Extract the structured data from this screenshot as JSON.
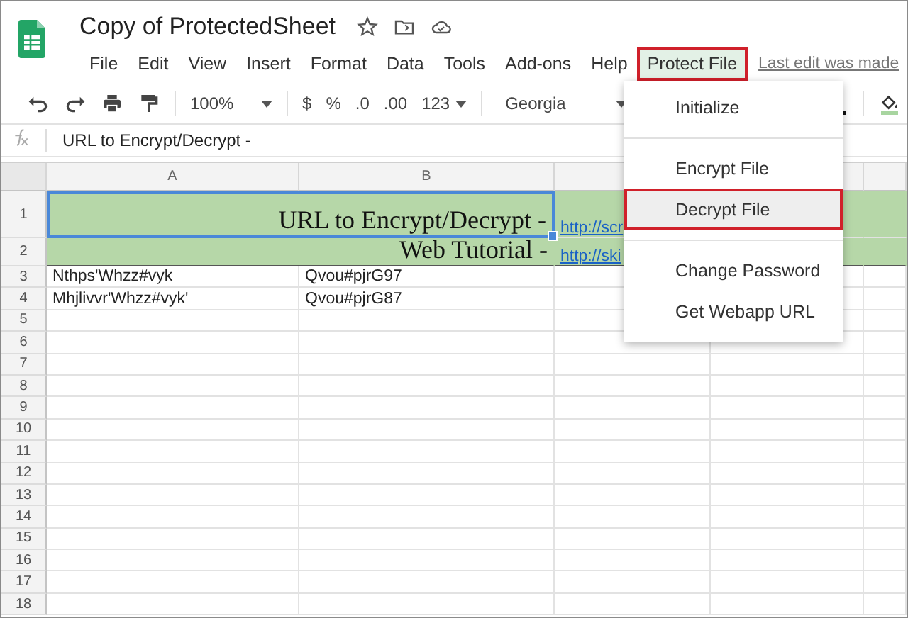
{
  "app": {
    "title": "Copy of ProtectedSheet"
  },
  "menu_bar": [
    {
      "label": "File",
      "selected": false
    },
    {
      "label": "Edit",
      "selected": false
    },
    {
      "label": "View",
      "selected": false
    },
    {
      "label": "Insert",
      "selected": false
    },
    {
      "label": "Format",
      "selected": false
    },
    {
      "label": "Data",
      "selected": false
    },
    {
      "label": "Tools",
      "selected": false
    },
    {
      "label": "Add-ons",
      "selected": false
    },
    {
      "label": "Help",
      "selected": false
    },
    {
      "label": "Protect File",
      "selected": true
    }
  ],
  "last_edit": "Last edit was made",
  "toolbar": {
    "zoom": "100%",
    "currency": "$",
    "percent": "%",
    "decrease_decimal": ".0",
    "increase_decimal": ".00",
    "more_formats": "123",
    "font": "Georgia"
  },
  "formula_bar": {
    "value": "URL to Encrypt/Decrypt -"
  },
  "sheet": {
    "columns": [
      "A",
      "B"
    ],
    "rows": [
      {
        "number": "1",
        "kind": "banner",
        "selected": true,
        "cells": [
          "URL to Encrypt/Decrypt -",
          "http://scr"
        ]
      },
      {
        "number": "2",
        "kind": "banner",
        "selected": false,
        "cells": [
          "Web Tutorial -",
          "http://ski"
        ]
      },
      {
        "number": "3",
        "kind": "data",
        "selected": false,
        "cells": [
          "Nthps'Whzz#vyk",
          "Qvou#pjrG97"
        ]
      },
      {
        "number": "4",
        "kind": "data",
        "selected": false,
        "cells": [
          "Mhjlivvr'Whzz#vyk'",
          "Qvou#pjrG87"
        ]
      },
      {
        "number": "5",
        "kind": "data",
        "selected": false,
        "cells": []
      },
      {
        "number": "6",
        "kind": "data",
        "selected": false,
        "cells": []
      },
      {
        "number": "7",
        "kind": "data",
        "selected": false,
        "cells": []
      },
      {
        "number": "8",
        "kind": "data",
        "selected": false,
        "cells": []
      },
      {
        "number": "9",
        "kind": "data",
        "selected": false,
        "cells": []
      },
      {
        "number": "10",
        "kind": "data",
        "selected": false,
        "cells": []
      },
      {
        "number": "11",
        "kind": "data",
        "selected": false,
        "cells": []
      },
      {
        "number": "12",
        "kind": "data",
        "selected": false,
        "cells": []
      },
      {
        "number": "13",
        "kind": "data",
        "selected": false,
        "cells": []
      },
      {
        "number": "14",
        "kind": "data",
        "selected": false,
        "cells": []
      },
      {
        "number": "15",
        "kind": "data",
        "selected": false,
        "cells": []
      },
      {
        "number": "16",
        "kind": "data",
        "selected": false,
        "cells": []
      },
      {
        "number": "17",
        "kind": "data",
        "selected": false,
        "cells": []
      },
      {
        "number": "18",
        "kind": "data",
        "selected": false,
        "cells": []
      }
    ]
  },
  "dropdown": [
    {
      "kind": "item",
      "label": "Initialize",
      "selected": false
    },
    {
      "kind": "separator"
    },
    {
      "kind": "item",
      "label": "Encrypt File",
      "selected": false
    },
    {
      "kind": "item",
      "label": "Decrypt File",
      "selected": true
    },
    {
      "kind": "separator"
    },
    {
      "kind": "item",
      "label": "Change Password",
      "selected": false
    },
    {
      "kind": "item",
      "label": "Get Webapp URL",
      "selected": false
    }
  ]
}
